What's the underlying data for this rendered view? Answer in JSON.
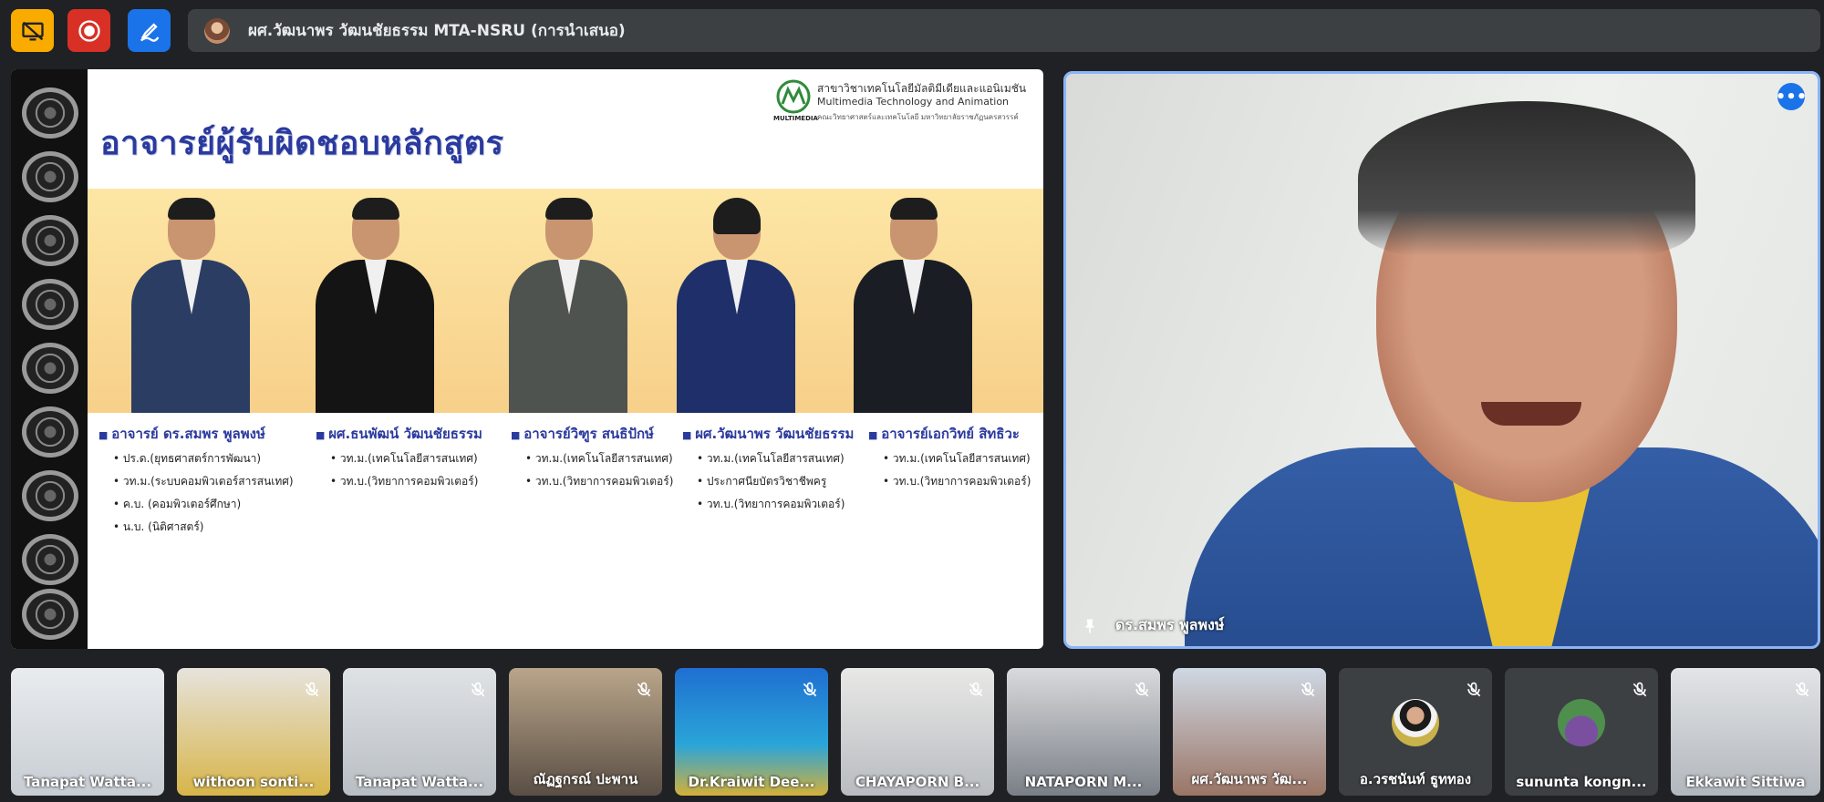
{
  "presenter": {
    "label": "ผศ.วัฒนาพร วัฒนชัยธรรม MTA-NSRU (การนำเสนอ)"
  },
  "colors": {
    "accent_yellow": "#f9ab00",
    "record_red": "#d93025",
    "annotate_blue": "#1a73e8",
    "highlight_border": "#8ab4f8"
  },
  "slide": {
    "title": "อาจารย์ผู้รับผิดชอบหลักสูตร",
    "logo": {
      "line1": "สาขาวิชาเทคโนโลยีมัลติมีเดียและแอนิเมชัน",
      "line2": "Multimedia Technology and Animation",
      "line3": "คณะวิทยาศาสตร์และเทคโนโลยี มหาวิทยาลัยราชภัฏนครสวรรค์",
      "word": "MULTIMEDIA"
    },
    "lecturers": [
      {
        "name": "อาจารย์ ดร.สมพร พูลพงษ์",
        "items": [
          "ปร.ด.(ยุทธศาสตร์การพัฒนา)",
          "วท.ม.(ระบบคอมพิวเตอร์สารสนเทศ)",
          "ค.บ. (คอมพิวเตอร์ศึกษา)",
          "น.บ. (นิติศาสตร์)"
        ]
      },
      {
        "name": "ผศ.ธนพัฒน์ วัฒนชัยธรรม",
        "items": [
          "วท.ม.(เทคโนโลยีสารสนเทศ)",
          "วท.บ.(วิทยาการคอมพิวเตอร์)"
        ]
      },
      {
        "name": "อาจารย์วิฑูร สนธิปักษ์",
        "items": [
          "วท.ม.(เทคโนโลยีสารสนเทศ)",
          "วท.บ.(วิทยาการคอมพิวเตอร์)"
        ]
      },
      {
        "name": "ผศ.วัฒนาพร วัฒนชัยธรรม",
        "items": [
          "วท.ม.(เทคโนโลยีสารสนเทศ)",
          "ประกาศนียบัตรวิชาชีพครู",
          "วท.บ.(วิทยาการคอมพิวเตอร์)"
        ]
      },
      {
        "name": "อาจารย์เอกวิทย์ สิทธิวะ",
        "items": [
          "วท.ม.(เทคโนโลยีสารสนเทศ)",
          "วท.บ.(วิทยาการคอมพิวเตอร์)"
        ]
      }
    ]
  },
  "speaker": {
    "name": "ดร.สมพร พูลพงษ์",
    "more": "•••"
  },
  "participants": [
    {
      "name": "Tanapat Watta...",
      "muted": false
    },
    {
      "name": "withoon sonti...",
      "muted": true
    },
    {
      "name": "Tanapat Watta...",
      "muted": true
    },
    {
      "name": "ณัฏฐกรณ์ ปะพาน",
      "muted": true
    },
    {
      "name": "Dr.Kraiwit Dee...",
      "muted": true
    },
    {
      "name": "CHAYAPORN B...",
      "muted": true
    },
    {
      "name": "NATAPORN M...",
      "muted": true
    },
    {
      "name": "ผศ.วัฒนาพร วัฒ...",
      "muted": true
    },
    {
      "name": "อ.วรชนันท์ ธูททอง",
      "muted": true
    },
    {
      "name": "sununta kongn...",
      "muted": true
    },
    {
      "name": "Ekkawit Sittiwa",
      "muted": true
    }
  ]
}
